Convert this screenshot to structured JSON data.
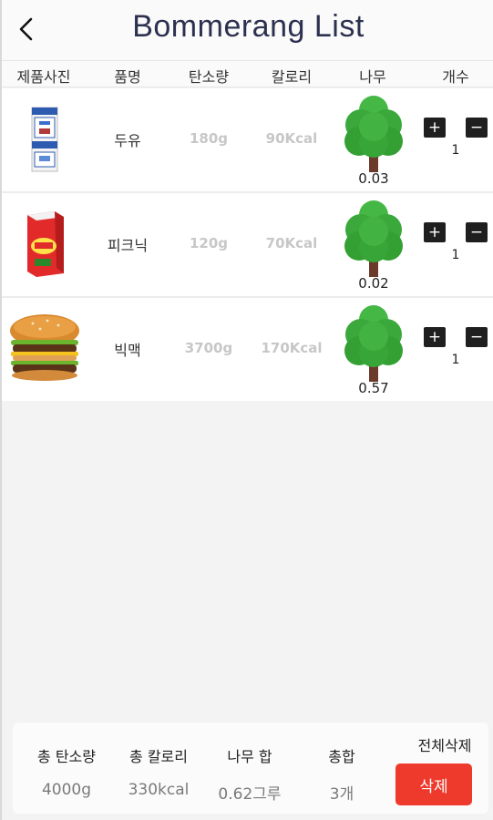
{
  "header": {
    "title": "Bommerang List"
  },
  "columns": [
    "제품사진",
    "품명",
    "탄소량",
    "칼로리",
    "나무",
    "개수"
  ],
  "items": [
    {
      "image": "soy-milk-carton",
      "name": "두유",
      "carbon": "180g",
      "calories": "90Kcal",
      "tree": "0.03",
      "count": "1"
    },
    {
      "image": "picnic-juice-box",
      "name": "피크닉",
      "carbon": "120g",
      "calories": "70Kcal",
      "tree": "0.02",
      "count": "1"
    },
    {
      "image": "big-mac-burger",
      "name": "빅맥",
      "carbon": "3700g",
      "calories": "170Kcal",
      "tree": "0.57",
      "count": "1"
    }
  ],
  "controls": {
    "plus": "+",
    "minus": "−"
  },
  "footer": {
    "total_carbon_label": "총 탄소량",
    "total_carbon_value": "4000g",
    "total_calories_label": "총 칼로리",
    "total_calories_value": "330kcal",
    "tree_sum_label": "나무 합",
    "tree_sum_value": "0.62그루",
    "total_label": "총합",
    "total_value": "3개",
    "delete_all_label": "전체삭제",
    "delete_button": "삭제"
  },
  "colors": {
    "title": "#2d3150",
    "delete": "#ee3a2c",
    "tree": "#3aa83a",
    "trunk": "#6b3a2a"
  },
  "icons": [
    "back-arrow-icon",
    "tree-icon",
    "plus-icon",
    "minus-icon"
  ]
}
